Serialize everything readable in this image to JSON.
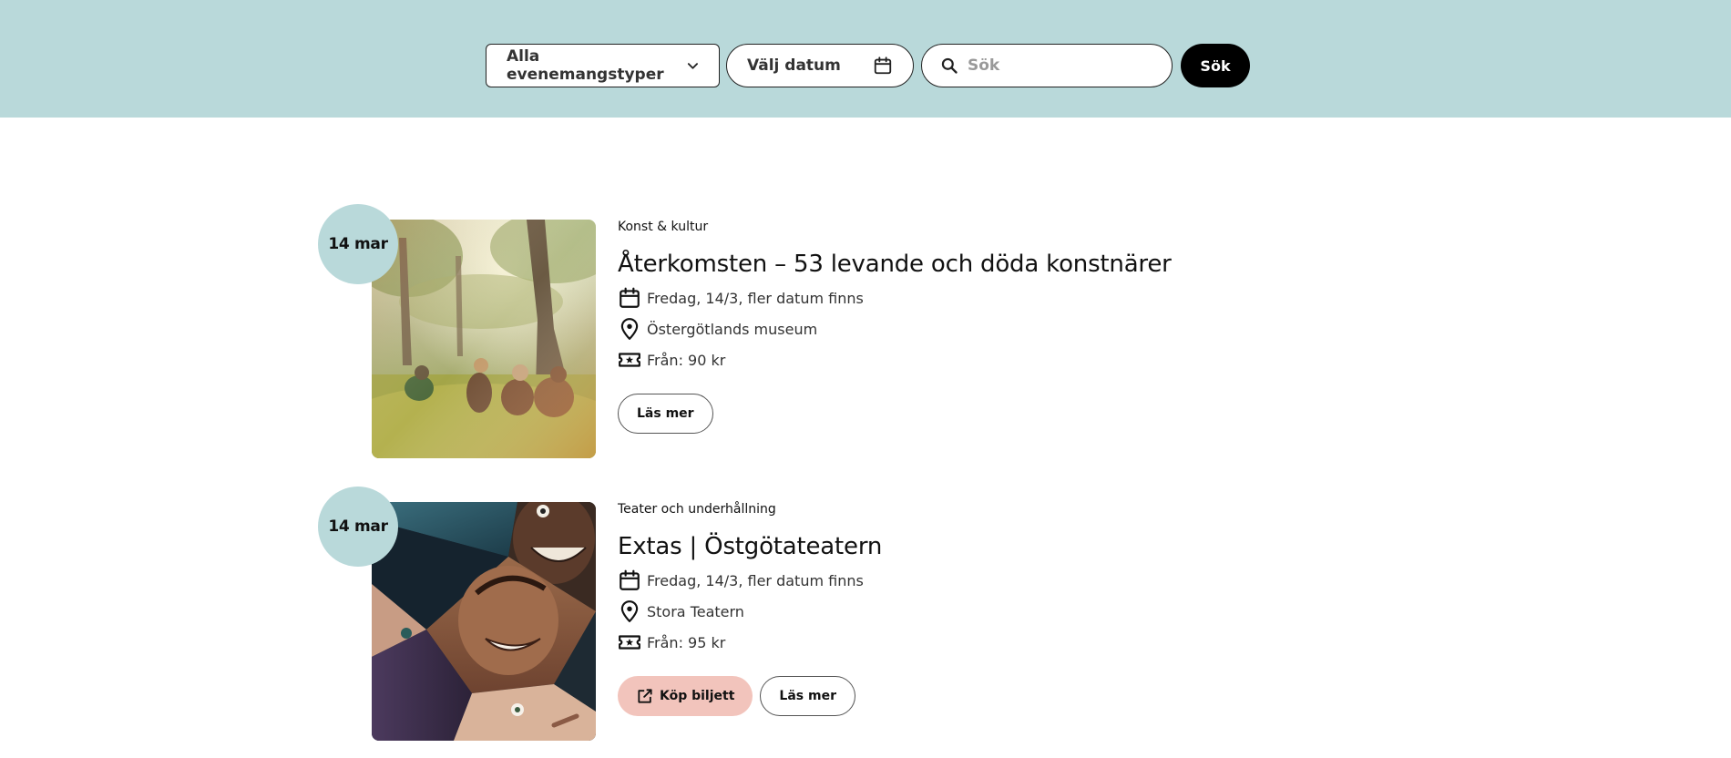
{
  "filters": {
    "event_type": "Alla evenemangstyper",
    "date_placeholder": "Välj datum",
    "search_placeholder": "Sök",
    "search_button": "Sök"
  },
  "events": [
    {
      "date_badge": "14 mar",
      "category": "Konst & kultur",
      "title": "Återkomsten – 53 levande och döda konstnärer",
      "date_text": "Fredag, 14/3, fler datum finns",
      "location": "Östergötlands museum",
      "price": "Från: 90 kr",
      "read_more": "Läs mer"
    },
    {
      "date_badge": "14 mar",
      "category": "Teater och underhållning",
      "title": "Extas | Östgötateatern",
      "date_text": "Fredag, 14/3, fler datum finns",
      "location": "Stora Teatern",
      "price": "Från: 95 kr",
      "buy_ticket": "Köp biljett",
      "read_more": "Läs mer"
    }
  ],
  "icons": {
    "chevron": "chevron-down-icon",
    "calendar": "calendar-icon",
    "search": "search-icon",
    "location": "location-pin-icon",
    "ticket": "ticket-icon",
    "external": "external-link-icon"
  },
  "colors": {
    "header_bg": "#b9d9da",
    "badge_bg": "#b9d9da",
    "buy_button": "#f2c4bc",
    "search_button": "#000000"
  }
}
